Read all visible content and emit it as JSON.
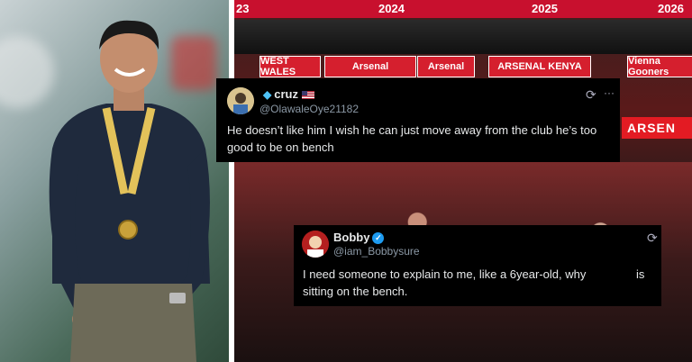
{
  "stadium": {
    "years": [
      "23",
      "2024",
      "2025",
      "2026"
    ],
    "boards": [
      "WEST WALES",
      "Arsenal",
      "Arsenal",
      "ARSENAL KENYA",
      "Vienna Gooners"
    ],
    "side_banner": "ARSEN"
  },
  "tweets": [
    {
      "name": "cruz",
      "handle": "@OlawaleOye21182",
      "text": "He doesn’t like him I wish he can just move away from the club he’s too good to be on bench",
      "avatar": "avatar-icon",
      "badge": "diamond-icon",
      "flag": "us-flag-icon"
    },
    {
      "name": "Bobby",
      "handle": "@iam_Bobbysure",
      "text_part1": "I need someone to explain to me, like a 6year-old, why",
      "text_part2": "is",
      "text_line2": "sitting on the bench.",
      "avatar": "avatar-icon",
      "badge": "verified-icon"
    }
  ],
  "icons": {
    "repost": "⟳",
    "more": "···",
    "check": "✓",
    "diamond": "◆"
  },
  "colors": {
    "arsenal_red": "#c8102e",
    "verified_blue": "#1d9bf0"
  }
}
